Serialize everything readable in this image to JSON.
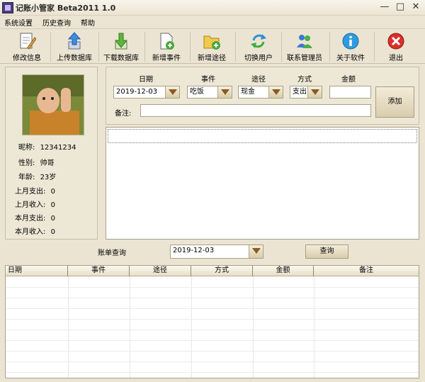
{
  "window": {
    "title": "记账小管家 Beta2011 1.0",
    "minimize": "—",
    "maximize": "□",
    "close": "✕"
  },
  "menu": [
    "系统设置",
    "历史查询",
    "帮助"
  ],
  "toolbar": [
    {
      "id": "edit-info",
      "label": "修改信息",
      "icon": "edit-document-icon"
    },
    {
      "id": "upload-db",
      "label": "上传数据库",
      "icon": "upload-icon"
    },
    {
      "id": "download-db",
      "label": "下载数据库",
      "icon": "download-icon"
    },
    {
      "id": "new-event",
      "label": "新增事件",
      "icon": "new-document-icon"
    },
    {
      "id": "new-channel",
      "label": "新增途径",
      "icon": "new-folder-icon"
    },
    {
      "id": "switch-user",
      "label": "切换用户",
      "icon": "switch-user-icon"
    },
    {
      "id": "contact-admin",
      "label": "联系管理员",
      "icon": "users-icon"
    },
    {
      "id": "about",
      "label": "关于软件",
      "icon": "info-icon"
    },
    {
      "id": "exit",
      "label": "退出",
      "icon": "exit-icon"
    }
  ],
  "profile": {
    "nickname_label": "昵称:",
    "nickname": "12341234",
    "gender_label": "性别:",
    "gender": "帅哥",
    "age_label": "年龄:",
    "age": "23岁",
    "last_month_expense_label": "上月支出:",
    "last_month_expense": "0",
    "last_month_income_label": "上月收入:",
    "last_month_income": "0",
    "this_month_expense_label": "本月支出:",
    "this_month_expense": "0",
    "this_month_income_label": "本月收入:",
    "this_month_income": "0"
  },
  "entry": {
    "date_label": "日期",
    "date_value": "2019-12-03",
    "event_label": "事件",
    "event_value": "吃饭",
    "channel_label": "途径",
    "channel_value": "现金",
    "mode_label": "方式",
    "mode_value": "支出",
    "amount_label": "金额",
    "amount_value": "",
    "note_label": "备注:",
    "note_value": "",
    "add_button": "添加"
  },
  "query": {
    "label": "账单查询",
    "date_value": "2019-12-03",
    "button": "查询"
  },
  "bills": {
    "columns": [
      "日期",
      "事件",
      "途径",
      "方式",
      "金额",
      "备注"
    ]
  },
  "colors": {
    "window_bg": "#ebe4d2",
    "panel_bg": "#ede7d6",
    "exit_red": "#d9302a",
    "dropdown_arrow": "#8a5a25"
  }
}
